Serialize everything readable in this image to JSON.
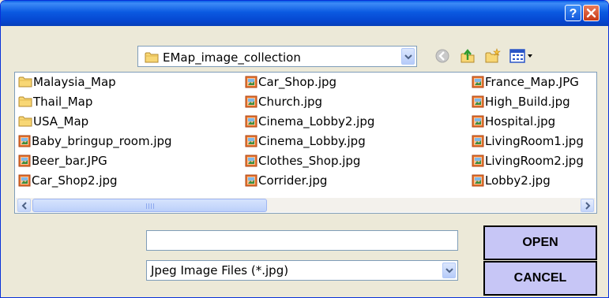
{
  "titlebar": {
    "help_button": "?",
    "close_button": "close"
  },
  "folder_combo": {
    "current": "EMap_image_collection",
    "icon": "folder-icon"
  },
  "toolbar": {
    "back": "back-icon",
    "up": "up-folder-icon",
    "new_folder": "new-folder-icon",
    "view_menu": "view-menu-icon"
  },
  "files": {
    "column1": [
      {
        "name": "Malaysia_Map",
        "type": "folder"
      },
      {
        "name": "Thail_Map",
        "type": "folder"
      },
      {
        "name": "USA_Map",
        "type": "folder"
      },
      {
        "name": "Baby_bringup_room.jpg",
        "type": "image"
      },
      {
        "name": "Beer_bar.JPG",
        "type": "image"
      },
      {
        "name": "Car_Shop2.jpg",
        "type": "image"
      }
    ],
    "column2": [
      {
        "name": "Car_Shop.jpg",
        "type": "image"
      },
      {
        "name": "Church.jpg",
        "type": "image"
      },
      {
        "name": "Cinema_Lobby2.jpg",
        "type": "image"
      },
      {
        "name": "Cinema_Lobby.jpg",
        "type": "image"
      },
      {
        "name": "Clothes_Shop.jpg",
        "type": "image"
      },
      {
        "name": "Corrider.jpg",
        "type": "image"
      }
    ],
    "column3": [
      {
        "name": "France_Map.JPG",
        "type": "image"
      },
      {
        "name": "High_Build.jpg",
        "type": "image"
      },
      {
        "name": "Hospital.jpg",
        "type": "image"
      },
      {
        "name": "LivingRoom1.jpg",
        "type": "image"
      },
      {
        "name": "LivingRoom2.jpg",
        "type": "image"
      },
      {
        "name": "Lobby2.jpg",
        "type": "image"
      }
    ]
  },
  "filename_input": {
    "value": ""
  },
  "filetype_combo": {
    "selected": "Jpeg Image Files (*.jpg)"
  },
  "buttons": {
    "open": "OPEN",
    "cancel": "CANCEL"
  },
  "colors": {
    "accent_button": "#C7C6F6",
    "titlebar": "#0B5AE1",
    "face": "#ECE9D8"
  }
}
